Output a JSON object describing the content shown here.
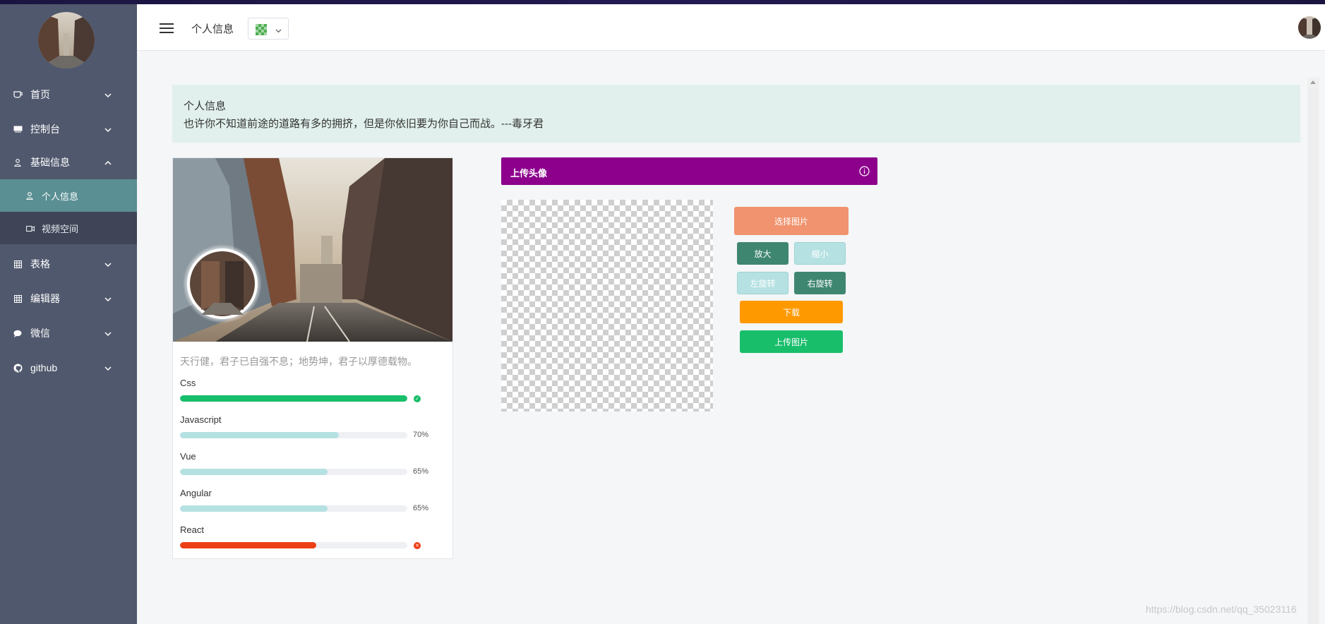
{
  "header": {
    "title": "个人信息"
  },
  "sidebar": {
    "items": [
      {
        "label": "首页",
        "icon": "coffee-cup-icon"
      },
      {
        "label": "控制台",
        "icon": "keyboard-icon"
      },
      {
        "label": "基础信息",
        "icon": "user-icon",
        "expanded": true
      },
      {
        "label": "表格",
        "icon": "grid-icon"
      },
      {
        "label": "编辑器",
        "icon": "grid-icon"
      },
      {
        "label": "微信",
        "icon": "chat-bubble-icon"
      },
      {
        "label": "github",
        "icon": "github-icon"
      }
    ],
    "subitems": [
      {
        "label": "个人信息",
        "icon": "user-icon",
        "active": true
      },
      {
        "label": "视频空间",
        "icon": "video-icon"
      }
    ]
  },
  "banner": {
    "title": "个人信息",
    "quote": "也许你不知道前途的道路有多的拥挤，但是你依旧要为你自己而战。---毒牙君"
  },
  "profile": {
    "motto": "天行健，君子已自强不息；地势坤，君子以厚德载物。",
    "skills": [
      {
        "name": "Css",
        "percent": 100,
        "status": "success",
        "color": "#19be6b"
      },
      {
        "name": "Javascript",
        "percent": 70,
        "label": "70%",
        "color": "#b5e1e2"
      },
      {
        "name": "Vue",
        "percent": 65,
        "label": "65%",
        "color": "#b5e1e2"
      },
      {
        "name": "Angular",
        "percent": 65,
        "label": "65%",
        "color": "#b5e1e2"
      },
      {
        "name": "React",
        "percent": 60,
        "status": "error",
        "color": "#ed3f14"
      }
    ]
  },
  "upload": {
    "title": "上传头像",
    "buttons": {
      "choose": "选择图片",
      "zoom_in": "放大",
      "zoom_out": "缩小",
      "rotate_left": "左旋转",
      "rotate_right": "右旋转",
      "download": "下载",
      "upload": "上传图片"
    }
  },
  "watermark": "https://blog.csdn.net/qq_35023116",
  "colors": {
    "sidebar_bg": "#50586d",
    "active_item": "#5a8f93",
    "upload_header": "#8c008c",
    "success": "#19be6b",
    "error": "#ed3f14",
    "warning": "#ff9900"
  }
}
